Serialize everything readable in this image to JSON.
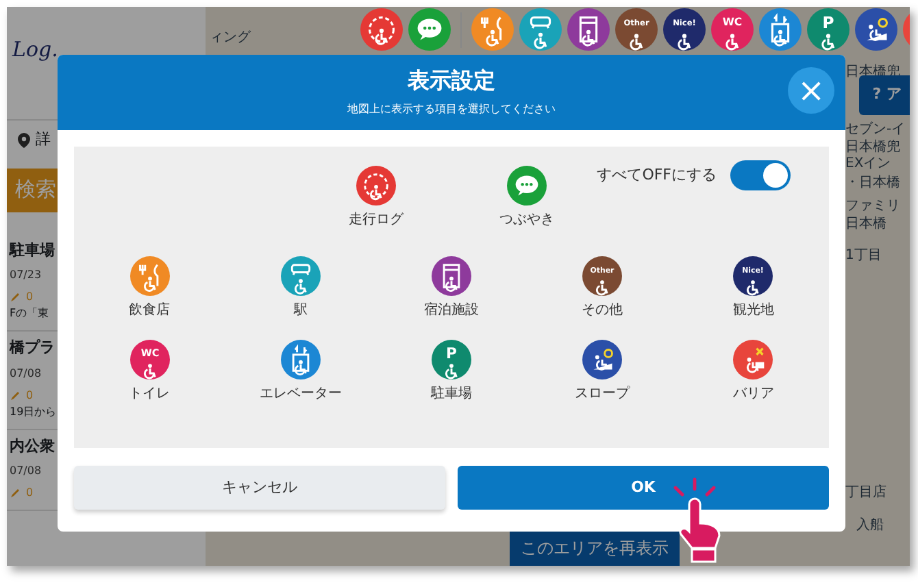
{
  "app": {
    "logo": "Log."
  },
  "sidebar": {
    "detail_label": "詳",
    "search_button": "検索",
    "posts": [
      {
        "title": "駐車場",
        "date": "07/23",
        "counts": [
          "0"
        ],
        "excerpt": "Fの「東"
      },
      {
        "title": "橋プラ",
        "date": "07/08",
        "counts": [
          "0"
        ],
        "excerpt": "19日から"
      },
      {
        "title": "内公衆",
        "date": "07/08",
        "counts": [
          "0"
        ]
      }
    ]
  },
  "map": {
    "labels": [
      "ィング",
      "日本橋兜",
      "セブン-イ",
      "日本橋兜",
      "EXイン",
      "・日本橋",
      "ファミリ",
      "日本橋",
      "1丁目",
      "丁目店",
      "入船"
    ],
    "help_button": "? ア",
    "reload_button": "このエリアを再表示"
  },
  "top_bar": {
    "posts": [
      {
        "kind": "log",
        "color": "#e53935"
      },
      {
        "kind": "chat",
        "color": "#1aa13a"
      }
    ],
    "categories": [
      {
        "kind": "food",
        "color": "#f08a24"
      },
      {
        "kind": "station",
        "color": "#1aa3b8"
      },
      {
        "kind": "hotel",
        "color": "#8e3a9c"
      },
      {
        "kind": "other",
        "color": "#7b4a32",
        "badge": "Other"
      },
      {
        "kind": "nice",
        "color": "#1f2a6b",
        "badge": "Nice!"
      },
      {
        "kind": "wc",
        "color": "#e0245e",
        "badge": "WC"
      },
      {
        "kind": "elevator",
        "color": "#1c87d4"
      },
      {
        "kind": "parking",
        "color": "#0f8a6e",
        "badge": "P"
      },
      {
        "kind": "slope",
        "color": "#2b4fa8"
      },
      {
        "kind": "barrier",
        "color": "#e8453c"
      }
    ]
  },
  "dialog": {
    "title": "表示設定",
    "subtitle": "地図上に表示する項目を選択してください",
    "close": "×",
    "all_off": {
      "label": "すべてOFFにする",
      "on": true
    },
    "featured": [
      {
        "kind": "log",
        "color": "#e53935",
        "label": "走行ログ"
      },
      {
        "kind": "chat",
        "color": "#1aa13a",
        "label": "つぶやき"
      }
    ],
    "categories": [
      {
        "kind": "food",
        "color": "#f08a24",
        "label": "飲食店"
      },
      {
        "kind": "station",
        "color": "#1aa3b8",
        "label": "駅"
      },
      {
        "kind": "hotel",
        "color": "#8e3a9c",
        "label": "宿泊施設"
      },
      {
        "kind": "other",
        "color": "#7b4a32",
        "label": "その他",
        "badge": "Other"
      },
      {
        "kind": "nice",
        "color": "#1f2a6b",
        "label": "観光地",
        "badge": "Nice!"
      },
      {
        "kind": "wc",
        "color": "#e0245e",
        "label": "トイレ",
        "badge": "WC"
      },
      {
        "kind": "elevator",
        "color": "#1c87d4",
        "label": "エレベーター"
      },
      {
        "kind": "parking",
        "color": "#0f8a6e",
        "label": "駐車場",
        "badge": "P"
      },
      {
        "kind": "slope",
        "color": "#2b4fa8",
        "label": "スロープ"
      },
      {
        "kind": "barrier",
        "color": "#e8453c",
        "label": "バリア"
      }
    ],
    "buttons": [
      {
        "kind": "secondary",
        "label": "キャンセル"
      },
      {
        "kind": "primary",
        "label": "OK"
      }
    ]
  }
}
